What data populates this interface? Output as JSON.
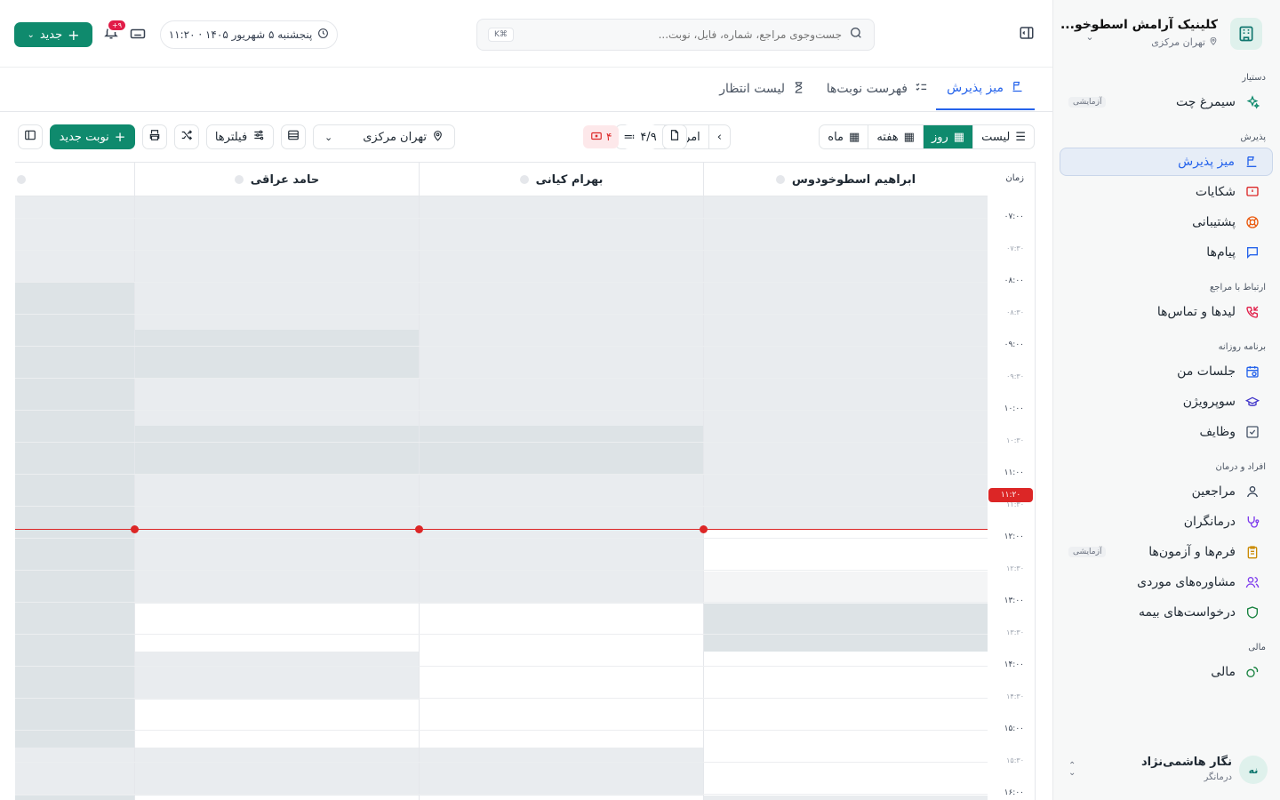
{
  "sidebar": {
    "clinic_name": "کلینیک آرامش اسطوخو...",
    "clinic_branch": "تهران مرکزی",
    "sections": [
      {
        "title": "دستیار",
        "items": [
          {
            "label": "سیمرغ چت",
            "badge": "آزمایشی"
          }
        ]
      },
      {
        "title": "پذیرش",
        "items": [
          {
            "label": "میز پذیرش"
          },
          {
            "label": "شکایات"
          },
          {
            "label": "پشتیبانی"
          },
          {
            "label": "پیام‌ها"
          }
        ]
      },
      {
        "title": "ارتباط با مراجع",
        "items": [
          {
            "label": "لیدها و تماس‌ها"
          }
        ]
      },
      {
        "title": "برنامه روزانه",
        "items": [
          {
            "label": "جلسات من"
          },
          {
            "label": "سوپرویژن"
          },
          {
            "label": "وظایف"
          }
        ]
      },
      {
        "title": "افراد و درمان",
        "items": [
          {
            "label": "مراجعین"
          },
          {
            "label": "درمانگران"
          },
          {
            "label": "فرم‌ها و آزمون‌ها",
            "badge": "آزمایشی"
          },
          {
            "label": "مشاوره‌های موردی"
          },
          {
            "label": "درخواست‌های بیمه"
          }
        ]
      },
      {
        "title": "مالی",
        "items": [
          {
            "label": "مالی"
          }
        ]
      }
    ],
    "user": {
      "initials": "نه",
      "name": "نگار هاشمی‌نژاد",
      "role": "درمانگر"
    }
  },
  "topbar": {
    "search_placeholder": "جست‌وجوی مراجع، شماره، فایل، نوبت...",
    "search_shortcut": "⌘K",
    "datetime": "پنجشنبه ۵ شهریور ۱۴۰۵ · ۱۱:۲۰",
    "notif_count": "۹+",
    "new_label": "جدید"
  },
  "tabs": [
    {
      "label": "میز پذیرش",
      "active": true
    },
    {
      "label": "فهرست نوبت‌ها",
      "active": false
    },
    {
      "label": "لیست انتظار",
      "active": false
    }
  ],
  "toolbar": {
    "view_list": "لیست",
    "view_day": "روز",
    "view_week": "هفته",
    "view_month": "ماه",
    "today": "امروز",
    "progress": "۴/۹",
    "cancelled_count": "۴",
    "location": "تهران مرکزی",
    "filters": "فیلترها",
    "new_appointment": "نوبت جدید"
  },
  "calendar": {
    "time_header": "زمان",
    "now_label": "۱۱:۲۰",
    "columns": [
      "ابراهیم اسطوخودوس",
      "بهرام کیانی",
      "حامد عراقی",
      ""
    ],
    "times": [
      {
        "label": "۰۷:۰۰",
        "half": false
      },
      {
        "label": "۰۷:۳۰",
        "half": true
      },
      {
        "label": "۰۸:۰۰",
        "half": false
      },
      {
        "label": "۰۸:۳۰",
        "half": true
      },
      {
        "label": "۰۹:۰۰",
        "half": false
      },
      {
        "label": "۰۹:۳۰",
        "half": true
      },
      {
        "label": "۱۰:۰۰",
        "half": false
      },
      {
        "label": "۱۰:۳۰",
        "half": true
      },
      {
        "label": "۱۱:۰۰",
        "half": false
      },
      {
        "label": "۱۱:۳۰",
        "half": true
      },
      {
        "label": "۱۲:۰۰",
        "half": false
      },
      {
        "label": "۱۲:۳۰",
        "half": true
      },
      {
        "label": "۱۳:۰۰",
        "half": false
      },
      {
        "label": "۱۳:۳۰",
        "half": true
      },
      {
        "label": "۱۴:۰۰",
        "half": false
      },
      {
        "label": "۱۴:۳۰",
        "half": true
      },
      {
        "label": "۱۵:۰۰",
        "half": false
      },
      {
        "label": "۱۵:۳۰",
        "half": true
      },
      {
        "label": "۱۶:۰۰",
        "half": false
      }
    ]
  },
  "colors": {
    "primary": "#0f8a6d",
    "accent": "#2563eb",
    "now": "#dc2626",
    "busy": "#e9ecef"
  }
}
